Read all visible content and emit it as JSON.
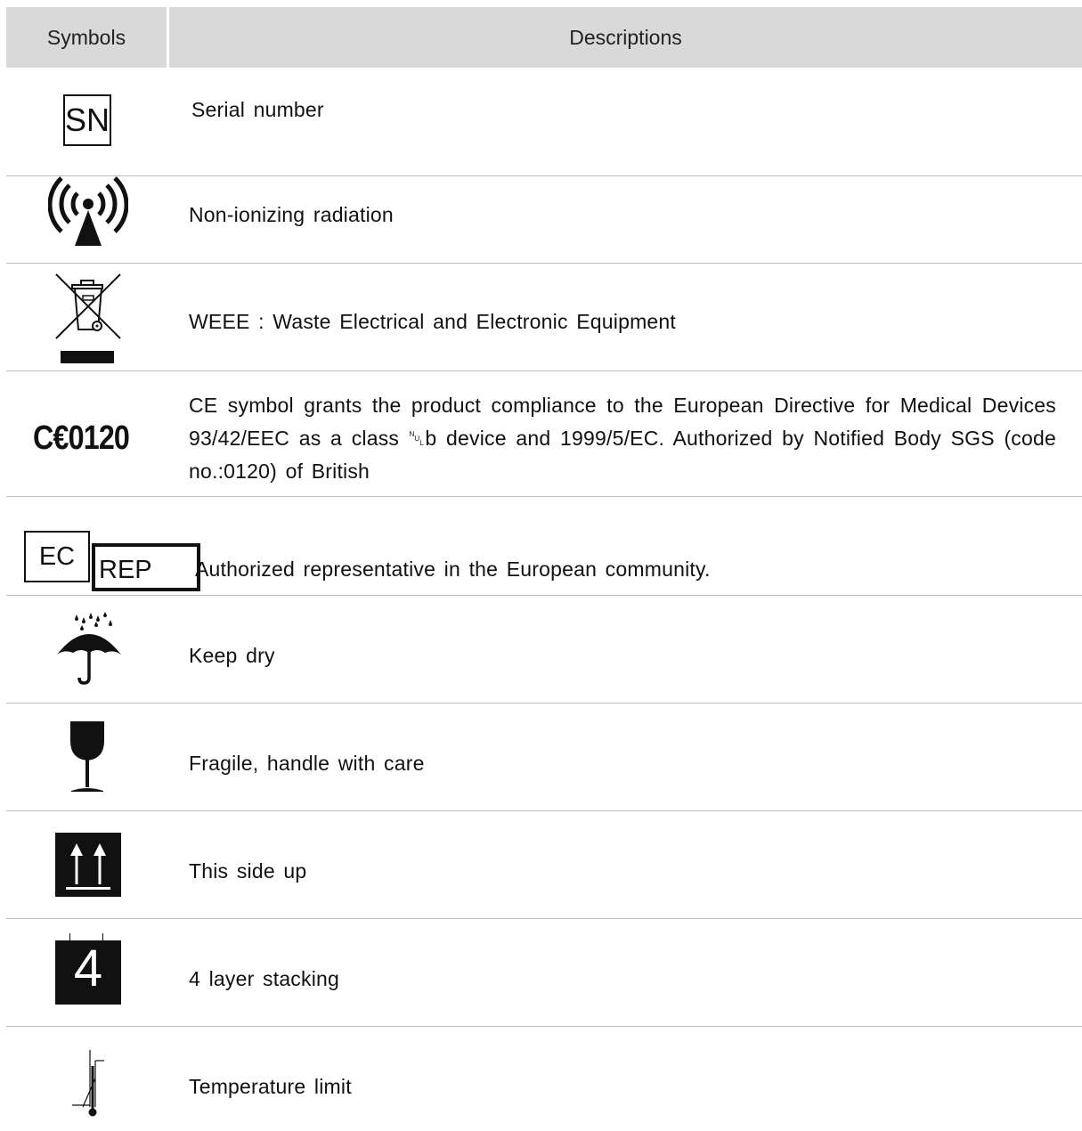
{
  "header": {
    "symbols_label": "Symbols",
    "descriptions_label": "Descriptions"
  },
  "rows": [
    {
      "symbol_text": "SN",
      "symbol_icon": "serial-number-icon",
      "description": "Serial number"
    },
    {
      "symbol_icon": "non-ionizing-radiation-icon",
      "description": "Non-ionizing radiation"
    },
    {
      "symbol_icon": "weee-crossed-bin-icon",
      "description": "WEEE : Waste Electrical and Electronic Equipment"
    },
    {
      "symbol_text": "C€0120",
      "symbol_icon": "ce-mark-icon",
      "description": "CE symbol grants the product compliance to the European Directive for Medical Devices 93/42/EEC as a class ␀b device and 1999/5/EC. Authorized by  Notified Body SGS (code no.:0120) of British"
    },
    {
      "symbol_text_1": "EC",
      "symbol_text_2": "REP",
      "symbol_icon": "ec-rep-icon",
      "description": "Authorized representative in the European community."
    },
    {
      "symbol_icon": "keep-dry-umbrella-icon",
      "description": "Keep dry"
    },
    {
      "symbol_icon": "fragile-glass-icon",
      "description": "Fragile, handle with care"
    },
    {
      "symbol_icon": "this-side-up-arrows-icon",
      "description": "This side up"
    },
    {
      "symbol_text": "4",
      "symbol_icon": "stacking-limit-icon",
      "description": "4 layer stacking"
    },
    {
      "symbol_icon": "temperature-limit-icon",
      "description": "Temperature limit"
    }
  ]
}
